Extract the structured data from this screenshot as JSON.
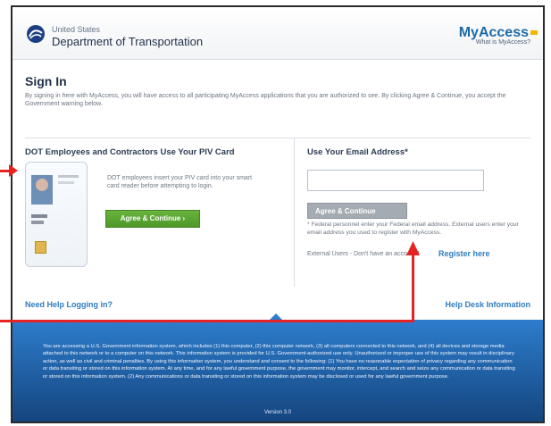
{
  "header": {
    "agency_line1": "United States",
    "agency_line2": "Department of Transportation",
    "brand": "MyAccess",
    "brand_sub": "What is MyAccess?"
  },
  "signin": {
    "title": "Sign In",
    "description": "By signing in here with MyAccess, you will have access to all participating MyAccess applications that you are authorized to see. By clicking Agree & Continue, you accept the Government warning below."
  },
  "left_panel": {
    "title": "DOT Employees and Contractors Use Your PIV Card",
    "description": "DOT employees insert your PIV card into your smart card reader before attempting to login.",
    "button": "Agree & Continue ›"
  },
  "right_panel": {
    "title": "Use Your Email Address*",
    "email_value": "",
    "button": "Agree & Continue",
    "note": "* Federal personnel enter your Federal email address. External users enter your email address you used to register with MyAccess.",
    "external_text": "External Users - Don't have an account?",
    "register": "Register here"
  },
  "links": {
    "need_help": "Need Help Logging in?",
    "help_desk": "Help Desk Information"
  },
  "notice": {
    "text": "You are accessing a U.S. Government information system, which includes (1) this computer, (2) this computer network, (3) all computers connected to this network, and (4) all devices and storage media attached to this network or to a computer on this network. This information system is provided for U.S. Government-authorized use only. Unauthorized or improper use of this system may result in disciplinary action, as well as civil and criminal penalties. By using this information system, you understand and consent to the following: (1) You have no reasonable expectation of privacy regarding any communication or data transiting or stored on this information system. At any time, and for any lawful government purpose, the government may monitor, intercept, and search and seize any communication or data transiting or stored on this information system. (2) Any communications or data transiting or stored on this information system may be disclosed or used for any lawful government purpose.",
    "version": "Version 3.0"
  },
  "colors": {
    "accent_blue": "#2f7dc1",
    "primary_green": "#5aa633",
    "notice_blue": "#1f5fa3",
    "annotation_red": "#e62323"
  }
}
